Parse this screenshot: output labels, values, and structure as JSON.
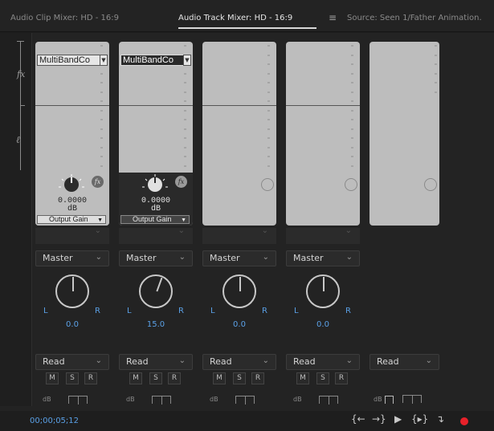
{
  "tabs": [
    {
      "label": "Audio Clip Mixer: HD - 16:9"
    },
    {
      "label": "Audio Track Mixer: HD - 16:9"
    },
    {
      "label": "Source: Seen 1/Father Animation."
    }
  ],
  "panel_menu_icon": "hamburger-icon",
  "rail": {
    "fx_label": "fx",
    "send_label": "­"
  },
  "strips": [
    {
      "effect": "MultiBandCo",
      "value": "0.0000",
      "unit": "dB",
      "param": "Output Gain",
      "output": "Master",
      "pan": "0.0",
      "pan_left": "L",
      "pan_right": "R",
      "automation": "Read",
      "m": "M",
      "s": "S",
      "r": "R",
      "db": "dB"
    },
    {
      "effect": "MultiBandCo",
      "value": "0.0000",
      "unit": "dB",
      "param": "Output Gain",
      "output": "Master",
      "pan": "15.0",
      "pan_left": "L",
      "pan_right": "R",
      "automation": "Read",
      "m": "M",
      "s": "S",
      "r": "R",
      "db": "dB"
    },
    {
      "output": "Master",
      "pan": "0.0",
      "pan_left": "L",
      "pan_right": "R",
      "automation": "Read",
      "m": "M",
      "s": "S",
      "r": "R",
      "db": "dB"
    },
    {
      "output": "Master",
      "pan": "0.0",
      "pan_left": "L",
      "pan_right": "R",
      "automation": "Read",
      "m": "M",
      "s": "S",
      "r": "R",
      "db": "dB"
    },
    {
      "automation": "Read",
      "db": "dB"
    }
  ],
  "fx_badge": "fx",
  "timecode": "00;00;05;12",
  "transport": [
    "go-to-in-icon",
    "go-to-out-icon",
    "play-icon",
    "play-in-to-out-icon",
    "loop-icon",
    "record-icon"
  ],
  "colors": {
    "accent": "#5aa0e6",
    "record": "#e8212a"
  }
}
